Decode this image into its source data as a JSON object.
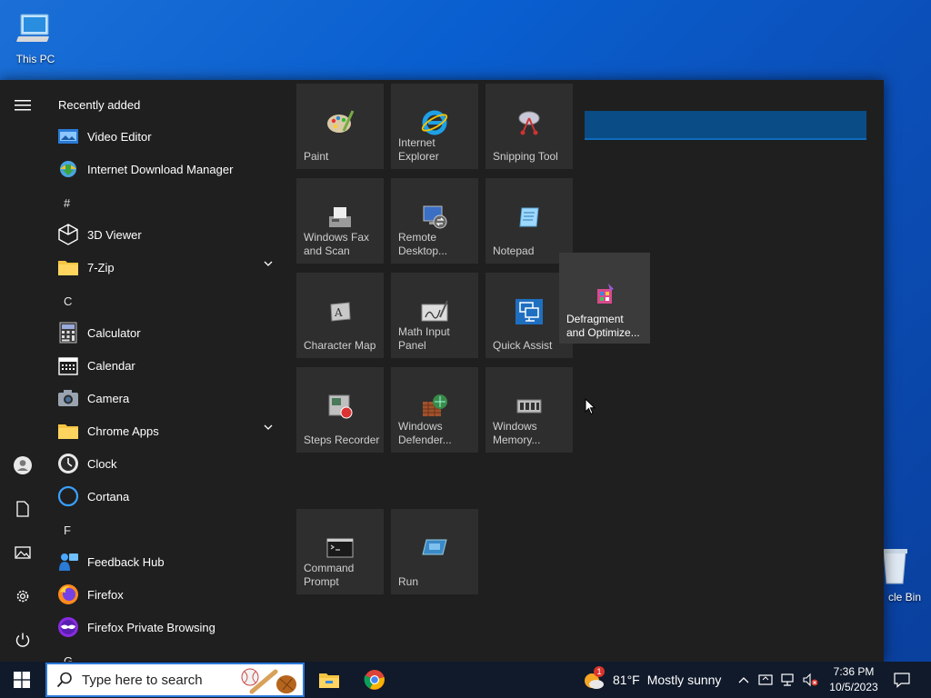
{
  "desktop": {
    "this_pc_label": "This PC",
    "recycle_bin_label": "cle Bin"
  },
  "start_menu": {
    "recently_added_title": "Recently added",
    "recent": [
      {
        "label": "Video Editor",
        "icon": "video-editor-icon"
      },
      {
        "label": "Internet Download Manager",
        "icon": "idm-icon"
      }
    ],
    "headers": {
      "hash": "#",
      "c": "C",
      "f": "F",
      "g": "G"
    },
    "apps": [
      {
        "label": "3D Viewer",
        "icon": "3d-viewer-icon"
      },
      {
        "label": "7-Zip",
        "icon": "folder-icon",
        "expandable": true
      },
      {
        "label": "Calculator",
        "icon": "calculator-icon"
      },
      {
        "label": "Calendar",
        "icon": "calendar-icon"
      },
      {
        "label": "Camera",
        "icon": "camera-icon"
      },
      {
        "label": "Chrome Apps",
        "icon": "folder-icon",
        "expandable": true
      },
      {
        "label": "Clock",
        "icon": "clock-icon"
      },
      {
        "label": "Cortana",
        "icon": "cortana-icon"
      },
      {
        "label": "Feedback Hub",
        "icon": "feedback-hub-icon"
      },
      {
        "label": "Firefox",
        "icon": "firefox-icon"
      },
      {
        "label": "Firefox Private Browsing",
        "icon": "firefox-private-icon"
      }
    ],
    "tiles": [
      {
        "label": "Paint",
        "icon": "paint-icon"
      },
      {
        "label": "Internet Explorer",
        "icon": "internet-explorer-icon"
      },
      {
        "label": "Snipping Tool",
        "icon": "snipping-tool-icon"
      },
      {
        "label": "Windows Fax and Scan",
        "icon": "fax-scan-icon"
      },
      {
        "label": "Remote Desktop...",
        "icon": "remote-desktop-icon"
      },
      {
        "label": "Notepad",
        "icon": "notepad-icon"
      },
      {
        "label": "Character Map",
        "icon": "character-map-icon"
      },
      {
        "label": "Math Input Panel",
        "icon": "math-input-icon"
      },
      {
        "label": "Quick Assist",
        "icon": "quick-assist-icon"
      },
      {
        "label": "Steps Recorder",
        "icon": "steps-recorder-icon"
      },
      {
        "label": "Windows Defender...",
        "icon": "defender-firewall-icon"
      },
      {
        "label": "Windows Memory...",
        "icon": "memory-diagnostic-icon"
      },
      {
        "label": "Command Prompt",
        "icon": "command-prompt-icon"
      },
      {
        "label": "Run",
        "icon": "run-icon"
      }
    ],
    "dragging_tile": {
      "label": "Defragment and Optimize...",
      "icon": "defragment-icon"
    }
  },
  "taskbar": {
    "search_placeholder": "Type here to search",
    "weather_temp": "81°F",
    "weather_text": "Mostly sunny",
    "weather_badge": "1",
    "time": "7:36 PM",
    "date": "10/5/2023"
  },
  "colors": {
    "accent": "#0a4c85",
    "start_bg": "#1f1f1f",
    "tile_bg": "#2e2e2e",
    "taskbar_bg": "#101a2b"
  }
}
